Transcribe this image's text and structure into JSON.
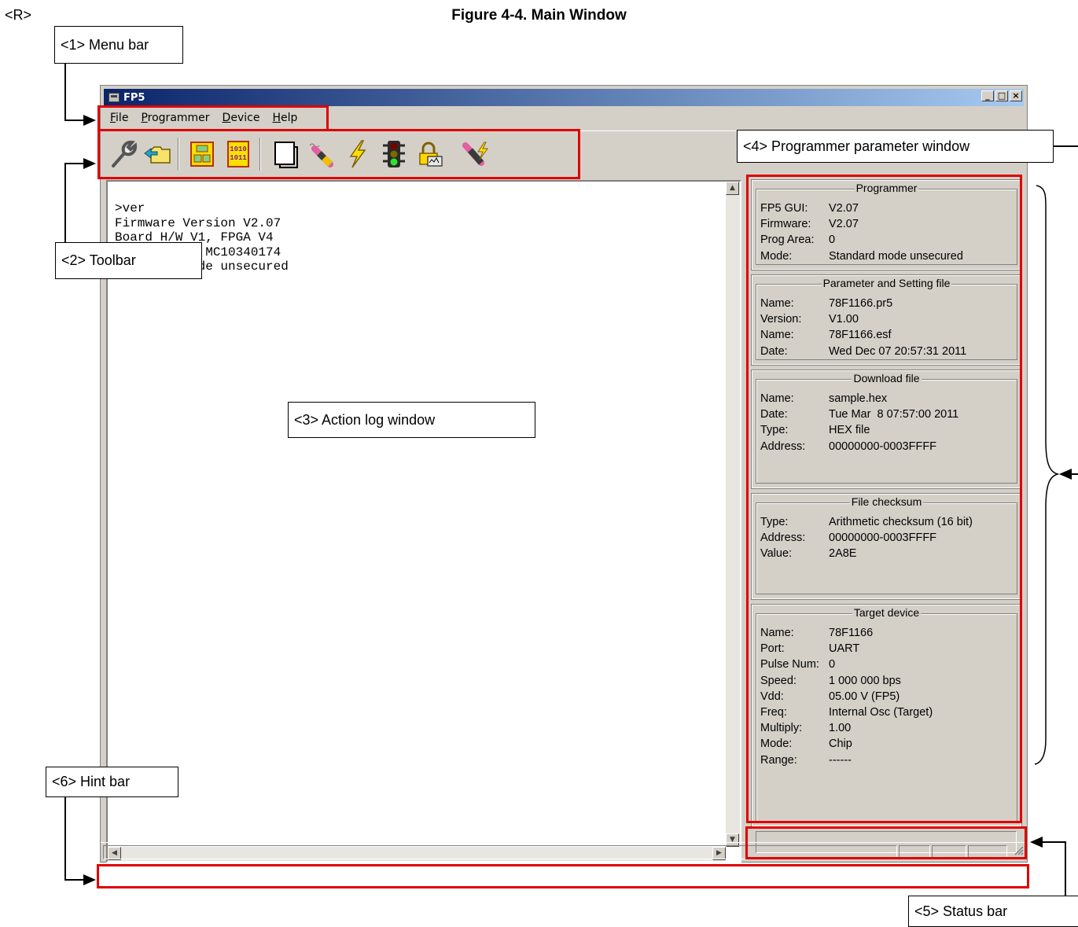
{
  "doc": {
    "revision_mark": "<R>",
    "figure_title": "Figure 4-4.  Main Window"
  },
  "callouts": {
    "menu_bar": "<1> Menu bar",
    "toolbar": "<2> Toolbar",
    "action_log": "<3> Action log window",
    "param_window": "<4> Programmer parameter window",
    "status_bar": "<5> Status bar",
    "hint_bar": "<6> Hint bar"
  },
  "window": {
    "title": "FP5",
    "controls": [
      "_",
      "□",
      "×"
    ]
  },
  "menu": [
    {
      "first": "F",
      "rest": "ile"
    },
    {
      "first": "P",
      "rest": "rogrammer"
    },
    {
      "first": "D",
      "rest": "evice"
    },
    {
      "first": "H",
      "rest": "elp"
    }
  ],
  "toolbar_icons": [
    "wrench-icon",
    "open-folder-icon",
    "chip-icon",
    "binary-file-icon",
    "blank-page-icon",
    "eraser-pencil-icon",
    "lightning-icon",
    "traffic-light-icon",
    "padlock-icon",
    "autoprocedure-icon"
  ],
  "log": {
    "text": ">ver\nFirmware Version V2.07\nBoard H/W V1, FPGA V4\nSerial No.: MC10340174\nStandard mode unsecured"
  },
  "panels": {
    "programmer": {
      "title": "Programmer",
      "rows": [
        {
          "k": "FP5 GUI:",
          "v": "V2.07"
        },
        {
          "k": "Firmware:",
          "v": "V2.07"
        },
        {
          "k": "Prog Area:",
          "v": "0"
        },
        {
          "k": "Mode:",
          "v": "Standard mode unsecured"
        }
      ]
    },
    "param": {
      "title": "Parameter and Setting file",
      "rows": [
        {
          "k": "Name:",
          "v": "78F1166.pr5"
        },
        {
          "k": "Version:",
          "v": "V1.00"
        },
        {
          "k": "Name:",
          "v": "78F1166.esf"
        },
        {
          "k": "Date:",
          "v": "Wed Dec 07 20:57:31 2011"
        }
      ]
    },
    "download": {
      "title": "Download file",
      "rows": [
        {
          "k": "Name:",
          "v": "sample.hex"
        },
        {
          "k": "Date:",
          "v": "Tue Mar  8 07:57:00 2011"
        },
        {
          "k": "Type:",
          "v": "HEX file"
        },
        {
          "k": "Address:",
          "v": "00000000-0003FFFF"
        }
      ]
    },
    "checksum": {
      "title": "File checksum",
      "rows": [
        {
          "k": "Type:",
          "v": "Arithmetic checksum (16 bit)"
        },
        {
          "k": "Address:",
          "v": "00000000-0003FFFF"
        },
        {
          "k": "Value:",
          "v": "2A8E"
        }
      ]
    },
    "target": {
      "title": "Target device",
      "rows": [
        {
          "k": "Name:",
          "v": "78F1166"
        },
        {
          "k": "Port:",
          "v": "UART"
        },
        {
          "k": "Pulse Num:",
          "v": "0"
        },
        {
          "k": "Speed:",
          "v": "1 000 000 bps"
        },
        {
          "k": "Vdd:",
          "v": "05.00 V (FP5)"
        },
        {
          "k": "Freq:",
          "v": "Internal Osc (Target)"
        },
        {
          "k": "Multiply:",
          "v": "1.00"
        },
        {
          "k": "Mode:",
          "v": "Chip"
        },
        {
          "k": "Range:",
          "v": "------"
        }
      ]
    }
  },
  "colors": {
    "highlight": "#e00000",
    "window_face": "#d4d0c8",
    "title_start": "#0a246a",
    "title_end": "#a6caf0"
  }
}
